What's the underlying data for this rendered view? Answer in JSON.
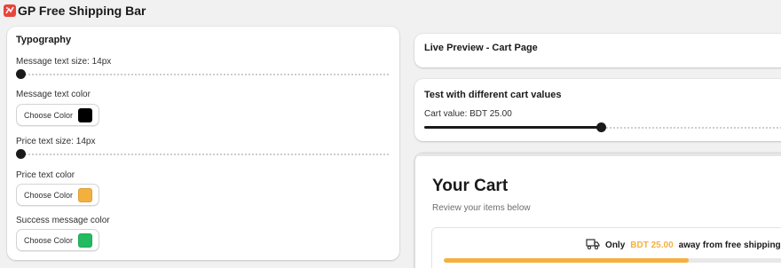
{
  "app": {
    "title": "GP Free Shipping Bar",
    "logo_icon": "app-logo-icon",
    "logo_color": "#e8453c"
  },
  "typography": {
    "heading": "Typography",
    "message_size_label": "Message text size: 14px",
    "message_size_level": 0,
    "message_color_label": "Message text color",
    "message_color": "#000000",
    "price_size_label": "Price text size: 14px",
    "price_size_level": 0,
    "price_color_label": "Price text color",
    "price_color": "#f4b03e",
    "success_color_label": "Success message color",
    "success_color": "#22bb5f",
    "choose_color_label": "Choose Color"
  },
  "preview": {
    "heading": "Live Preview - Cart Page"
  },
  "test": {
    "heading": "Test with different cart values",
    "cart_value_label": "Cart value: BDT 25.00",
    "slider_level": 0.475
  },
  "cart": {
    "title": "Your Cart",
    "subtitle": "Review your items below",
    "truck_icon": "truck-icon",
    "msg_prefix": "Only",
    "msg_price": "BDT 25.00",
    "msg_suffix": "away from free shipping!",
    "progress": 0.72,
    "accent": "#f4b03e"
  }
}
